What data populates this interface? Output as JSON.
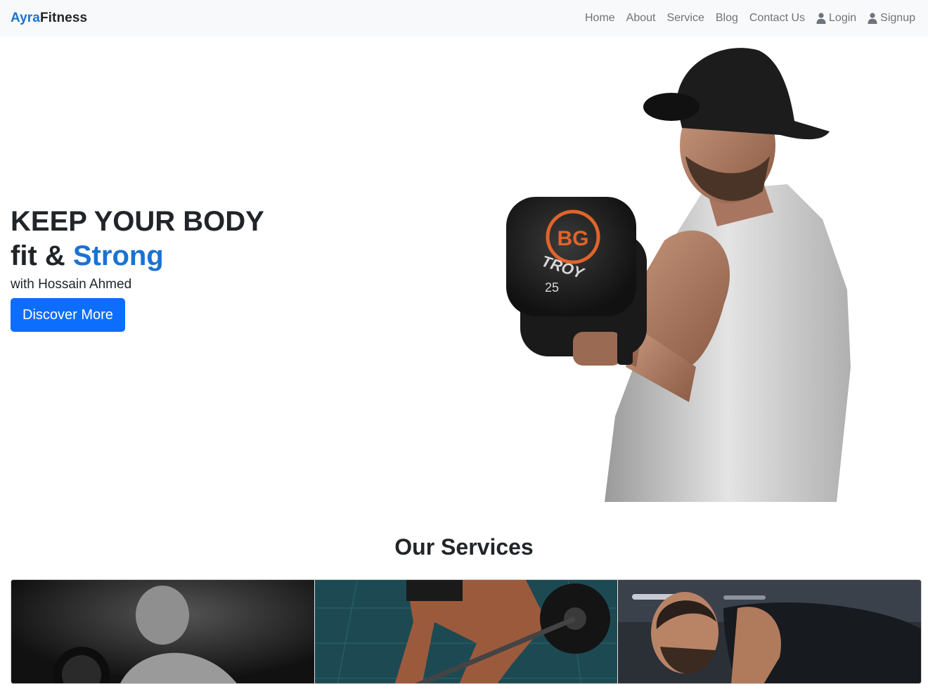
{
  "brand": {
    "accent": "Ayra",
    "main": "Fitness"
  },
  "nav": {
    "items": [
      "Home",
      "About",
      "Service",
      "Blog",
      "Contact Us"
    ],
    "login": "Login",
    "signup": "Signup"
  },
  "hero": {
    "line1": "KEEP YOUR BODY",
    "line2_prefix": "fit & ",
    "line2_accent": "Strong",
    "subtitle": "with Hossain Ahmed",
    "cta": "Discover More",
    "dumbbell_brand": "TROY",
    "dumbbell_weight": "25",
    "dumbbell_logo": "BG"
  },
  "services": {
    "title": "Our Services"
  },
  "colors": {
    "accent": "#1a73d2",
    "button": "#0d6efd",
    "navbar_bg": "#f8f9fa"
  }
}
